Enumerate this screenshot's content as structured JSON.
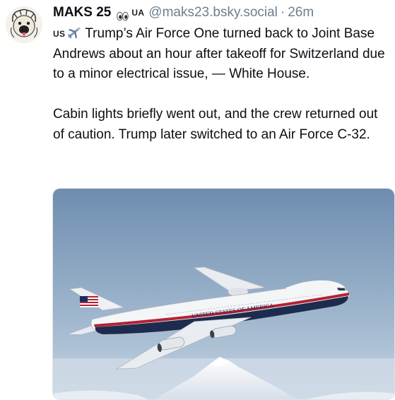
{
  "post": {
    "author": {
      "display_name": "MAKS 25",
      "flag_label": "UA",
      "handle": "@maks23.bsky.social",
      "separator": "·",
      "timestamp": "26m",
      "avatar_icon": "cartoon-face-avatar",
      "badge_icon": "eyes-emoji-icon"
    },
    "text": {
      "prefix_label": "US",
      "prefix_icon": "airplane-emoji-icon",
      "paragraph_1": "Trump’s Air Force One turned back to Joint Base Andrews about an hour after takeoff for Switzerland due to a minor electrical issue, — White House.",
      "paragraph_2": "Cabin lights briefly went out, and the crew returned out of caution. Trump later switched to an Air Force C-32."
    },
    "image": {
      "description_icon": "air-force-one-jet-photo",
      "fuselage_text": "UNITED STATES OF AMERICA",
      "colors": {
        "sky_top": "#6e8daf",
        "sky_bottom": "#b9cbdd",
        "fuselage": "#f4f5f7",
        "stripe_red": "#b22234",
        "belly_navy": "#1d2b4f"
      }
    }
  }
}
